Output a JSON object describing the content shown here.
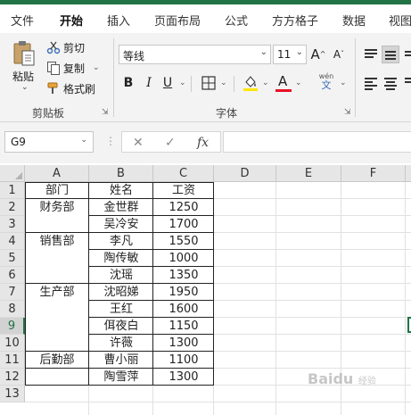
{
  "ribbon_tabs": [
    "文件",
    "开始",
    "插入",
    "页面布局",
    "公式",
    "方方格子",
    "数据",
    "视图"
  ],
  "active_tab": "开始",
  "clipboard": {
    "paste_label": "粘贴",
    "cut_label": "剪切",
    "copy_label": "复制",
    "format_painter_label": "格式刷",
    "group_label": "剪贴板"
  },
  "font": {
    "name": "等线",
    "size": "11",
    "group_label": "字体",
    "bold": "B",
    "italic": "I",
    "underline": "U",
    "grow": "A",
    "shrink": "A",
    "phonetic_top": "wén",
    "phonetic_bottom": "文",
    "highlight_color": "#ffe600",
    "font_color": "#e81123"
  },
  "formula_bar": {
    "name_box": "G9",
    "fx": "fx",
    "formula": ""
  },
  "grid": {
    "columns": [
      "A",
      "B",
      "C",
      "D",
      "E",
      "F"
    ],
    "rows": [
      "1",
      "2",
      "3",
      "4",
      "5",
      "6",
      "7",
      "8",
      "9",
      "10",
      "11",
      "12",
      "13"
    ],
    "selected_row": "9",
    "cells": {
      "A1": "部门",
      "B1": "姓名",
      "C1": "工资",
      "A2": "财务部",
      "B2": "金世群",
      "C2": "1250",
      "B3": "吴冷安",
      "C3": "1700",
      "A4": "销售部",
      "B4": "李凡",
      "C4": "1550",
      "B5": "陶传敏",
      "C5": "1000",
      "B6": "沈瑶",
      "C6": "1350",
      "A7": "生产部",
      "B7": "沈昭娣",
      "C7": "1950",
      "B8": "王红",
      "C8": "1600",
      "B9": "佴夜白",
      "C9": "1150",
      "B10": "许薇",
      "C10": "1300",
      "A11": "后勤部",
      "B11": "曹小丽",
      "C11": "1100",
      "B12": "陶雪萍",
      "C12": "1300"
    }
  },
  "watermark": {
    "main": "Baidu",
    "sub": "经验"
  }
}
